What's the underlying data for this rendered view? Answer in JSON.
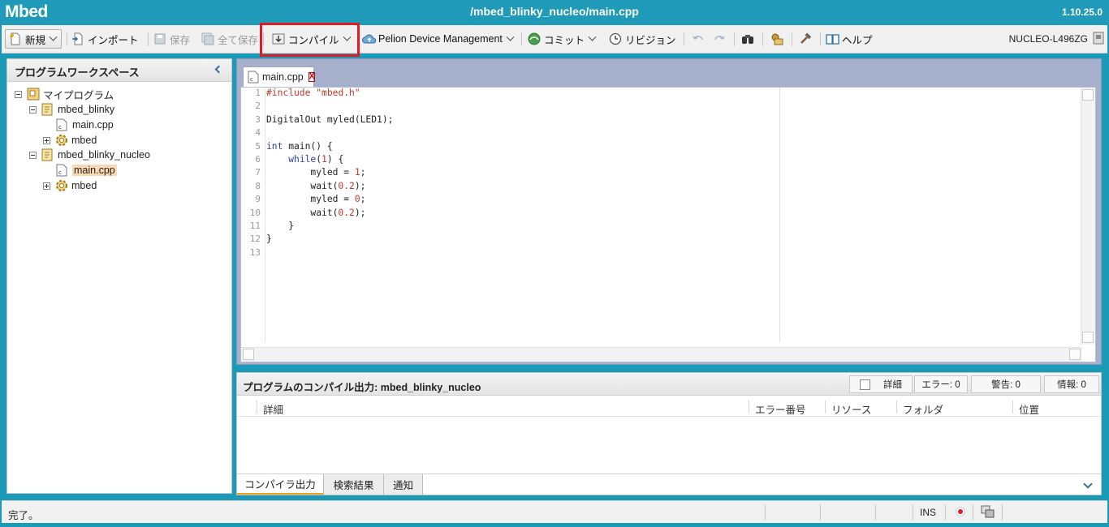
{
  "app": {
    "logo": "Mbed",
    "path": "/mbed_blinky_nucleo/main.cpp",
    "version": "1.10.25.0"
  },
  "toolbar": {
    "new_label": "新規",
    "import_label": "インポート",
    "save_label": "保存",
    "save_all_label": "全て保存",
    "compile_label": "コンパイル",
    "pelion_label": "Pelion Device Management",
    "commit_label": "コミット",
    "revision_label": "リビジョン",
    "help_label": "ヘルプ",
    "board_label": "NUCLEO-L496ZG"
  },
  "workspace": {
    "title": "プログラムワークスペース",
    "tree": [
      {
        "label": "マイプログラム"
      },
      {
        "label": "mbed_blinky"
      },
      {
        "label": "main.cpp"
      },
      {
        "label": "mbed"
      },
      {
        "label": "mbed_blinky_nucleo"
      },
      {
        "label": "main.cpp",
        "selected": true
      },
      {
        "label": "mbed"
      }
    ]
  },
  "editor": {
    "tab_label": "main.cpp",
    "tab_close": "X",
    "line_numbers": [
      "1",
      "2",
      "3",
      "4",
      "5",
      "6",
      "7",
      "8",
      "9",
      "10",
      "11",
      "12",
      "13"
    ],
    "code": [
      "#include \"mbed.h\"",
      "",
      "DigitalOut myled(LED1);",
      "",
      "int main() {",
      "    while(1) {",
      "        myled = 1;",
      "        wait(0.2);",
      "        myled = 0;",
      "        wait(0.2);",
      "    }",
      "}",
      ""
    ]
  },
  "output": {
    "title": "プログラムのコンパイル出力: mbed_blinky_nucleo",
    "details_toggle": "詳細",
    "errors": "エラー: 0",
    "warnings": "警告: 0",
    "info": "情報: 0",
    "columns": [
      "詳細",
      "エラー番号",
      "リソース",
      "フォルダ",
      "位置"
    ],
    "tabs": [
      "コンパイラ出力",
      "検索結果",
      "通知"
    ]
  },
  "status": {
    "message": "完了。",
    "mode": "INS"
  },
  "colors": {
    "titlebar": "#1f9bb9",
    "highlight": "#e01b24",
    "selection": "#fbd8b2"
  }
}
